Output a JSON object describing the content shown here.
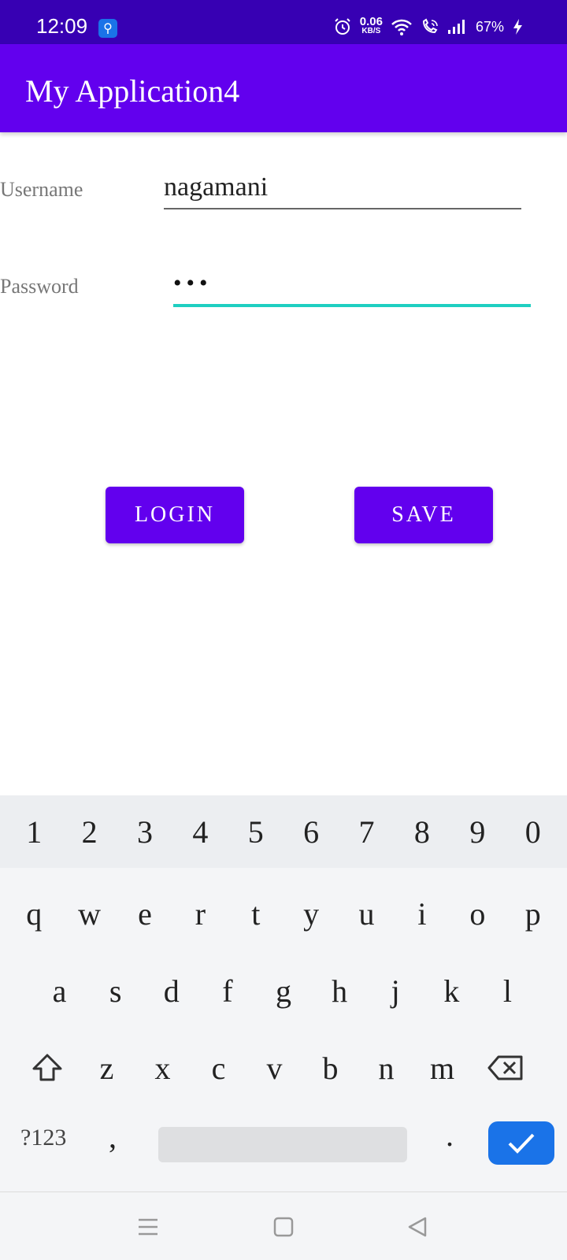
{
  "status_bar": {
    "time": "12:09",
    "net_speed_value": "0.06",
    "net_speed_unit": "KB/S",
    "battery": "67%",
    "icons": [
      "usb-icon",
      "alarm-icon",
      "wifi-icon",
      "wifi-calling-icon",
      "signal-icon",
      "charging-icon"
    ]
  },
  "app_bar": {
    "title": "My Application4"
  },
  "form": {
    "username_label": "Username",
    "username_value": "nagamani",
    "password_label": "Password",
    "password_value": "•••"
  },
  "buttons": {
    "login": "LOGIN",
    "save": "SAVE"
  },
  "keyboard": {
    "number_row": [
      "1",
      "2",
      "3",
      "4",
      "5",
      "6",
      "7",
      "8",
      "9",
      "0"
    ],
    "row1": [
      "q",
      "w",
      "e",
      "r",
      "t",
      "y",
      "u",
      "i",
      "o",
      "p"
    ],
    "row2": [
      "a",
      "s",
      "d",
      "f",
      "g",
      "h",
      "j",
      "k",
      "l"
    ],
    "row3": [
      "z",
      "x",
      "c",
      "v",
      "b",
      "n",
      "m"
    ],
    "symbols_key": "?123",
    "comma_key": ",",
    "period_key": ".",
    "accent_color": "#1a73e8"
  },
  "colors": {
    "status_bar": "#3700b3",
    "app_bar": "#6200ee",
    "focus_underline": "#1fcfc1"
  }
}
